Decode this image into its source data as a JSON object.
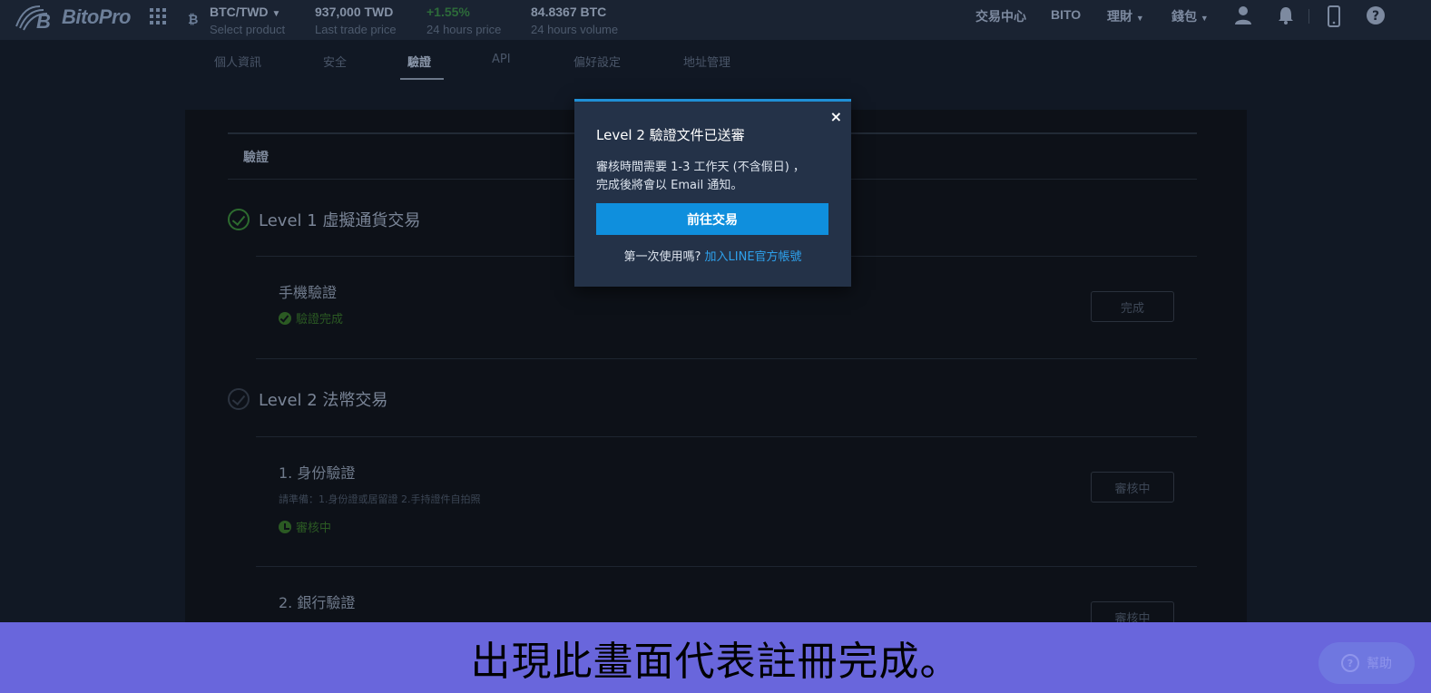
{
  "brand": {
    "name": "BitoPro"
  },
  "ticker": {
    "pair": "BTC/TWD",
    "pair_sub": "Select product",
    "last_price": "937,000 TWD",
    "last_price_label": "Last trade price",
    "change": "+1.55%",
    "change_label": "24 hours price",
    "volume": "84.8367 BTC",
    "volume_label": "24 hours volume"
  },
  "nav": {
    "trade_center": "交易中心",
    "bito": "BITO",
    "finance": "理財",
    "wallet": "錢包"
  },
  "tabs": [
    {
      "label": "個人資訊"
    },
    {
      "label": "安全"
    },
    {
      "label": "驗證"
    },
    {
      "label": "API"
    },
    {
      "label": "偏好設定"
    },
    {
      "label": "地址管理"
    }
  ],
  "verification": {
    "section_title": "驗證",
    "level1": {
      "title": "Level 1 虛擬通貨交易",
      "item_title": "手機驗證",
      "item_status": "驗證完成",
      "button": "完成"
    },
    "level2": {
      "title": "Level 2 法幣交易",
      "identity_title": "1. 身份驗證",
      "identity_note": "請準備：1.身份證或居留證 2.手持證件自拍照",
      "identity_status": "審核中",
      "identity_button": "審核中",
      "bank_title": "2. 銀行驗證",
      "bank_button": "審核中"
    }
  },
  "modal": {
    "title": "Level 2 驗證文件已送審",
    "body_line1": "審核時間需要 1-3 工作天 (不含假日) ，",
    "body_line2": "完成後將會以 Email 通知。",
    "button": "前往交易",
    "footer_text": "第一次使用嗎?",
    "footer_link": "加入LINE官方帳號",
    "close": "×"
  },
  "caption": {
    "text": "出現此畫面代表註冊完成。"
  },
  "help": {
    "label": "幫助"
  },
  "colors": {
    "accent": "#0f8fdd",
    "link": "#2ea1ec",
    "caption_bg": "#6966dc",
    "success": "#2b5a23"
  }
}
